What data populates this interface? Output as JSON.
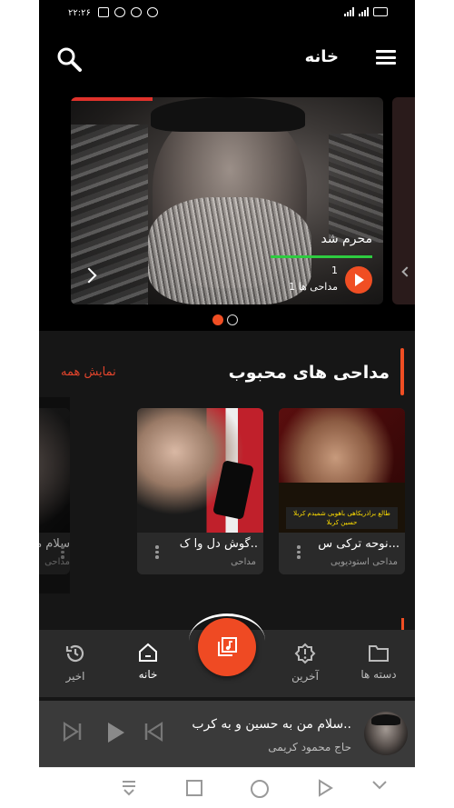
{
  "status_bar": {
    "time": "۲۲:۲۶"
  },
  "app_bar": {
    "title": "خانه"
  },
  "banner": {
    "title": "محرم شد",
    "count": "1",
    "category": "1 مداحی ها"
  },
  "section": {
    "title": "مداحی های محبوب",
    "show_all": "نمایش همه"
  },
  "cards": [
    {
      "title": "نوحه ترکی س...",
      "subtitle": "مداحی استودیویی",
      "image_text": "طالع براذریکاهی باهوبی\nشمیدم کربلا حسین کربلا"
    },
    {
      "title": "گوش دل وا ک..",
      "subtitle": "مداحی"
    },
    {
      "title": "سلام من ب",
      "subtitle": "مداحی"
    }
  ],
  "bottom_nav": {
    "categories": "دسته ها",
    "latest": "آخرین",
    "home": "خانه",
    "recent": "اخیر"
  },
  "player": {
    "title": "سلام من به حسین و به کرب..",
    "artist": "حاج محمود کریمی"
  },
  "colors": {
    "accent": "#ef4a23",
    "progress": "#2ecc40",
    "background": "#161616"
  }
}
